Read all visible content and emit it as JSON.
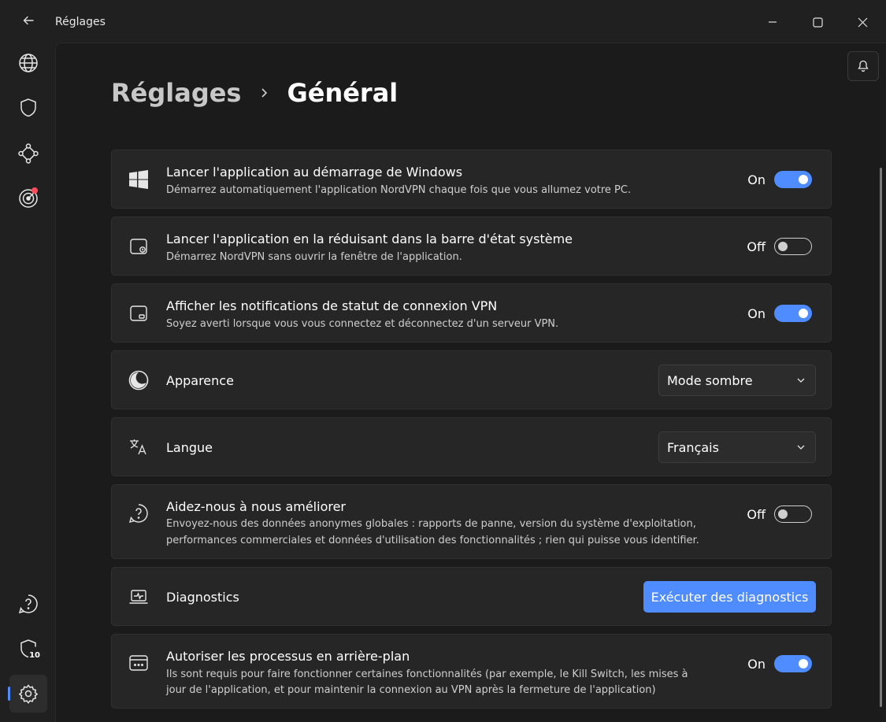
{
  "window": {
    "title": "Réglages"
  },
  "breadcrumb": {
    "root": "Réglages",
    "current": "Général"
  },
  "rail": {
    "shield_badge": "10"
  },
  "settings": [
    {
      "id": "startup",
      "title": "Lancer l'application au démarrage de Windows",
      "desc": "Démarrez automatiquement l'application NordVPN chaque fois que vous allumez votre PC.",
      "state_label": "On",
      "on": true
    },
    {
      "id": "tray",
      "title": "Lancer l'application en la réduisant dans la barre d'état système",
      "desc": "Démarrez NordVPN sans ouvrir la fenêtre de l'application.",
      "state_label": "Off",
      "on": false
    },
    {
      "id": "notifications",
      "title": "Afficher les notifications de statut de connexion VPN",
      "desc": "Soyez averti lorsque vous vous connectez et déconnectez d'un serveur VPN.",
      "state_label": "On",
      "on": true
    },
    {
      "id": "appearance",
      "title": "Apparence",
      "value": "Mode sombre"
    },
    {
      "id": "language",
      "title": "Langue",
      "value": "Français"
    },
    {
      "id": "improve",
      "title": "Aidez-nous à nous améliorer",
      "desc_lines": [
        "Envoyez-nous des données anonymes globales : rapports de panne, version du système d'exploitation,",
        "performances commerciales et données d'utilisation des fonctionnalités ; rien qui puisse vous identifier."
      ],
      "state_label": "Off",
      "on": false
    },
    {
      "id": "diagnostics",
      "title": "Diagnostics",
      "button": "Exécuter des diagnostics"
    },
    {
      "id": "background",
      "title": "Autoriser les processus en arrière-plan",
      "desc_lines": [
        "Ils sont requis pour faire fonctionner certaines fonctionnalités (par exemple, le Kill Switch, les mises à",
        "jour de l'application, et pour maintenir la connexion au VPN après la fermeture de l'application)"
      ],
      "state_label": "On",
      "on": true
    }
  ],
  "colors": {
    "accent": "#4e8cff",
    "badge": "#ff4d5b",
    "card": "#262626",
    "content_bg": "#1b1b1b"
  }
}
